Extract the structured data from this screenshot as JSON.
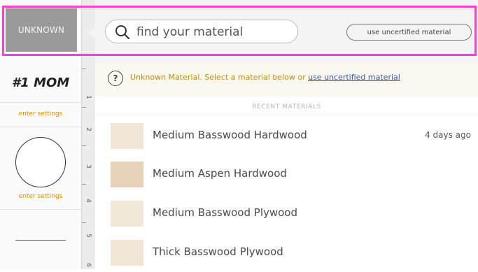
{
  "material_tab": {
    "label": "UNKNOWN"
  },
  "design_panel": {
    "title": "#1 MOM",
    "enter_settings_1": "enter settings",
    "enter_settings_2": "enter settings"
  },
  "ruler": {
    "marks": [
      "1",
      "2",
      "3",
      "4",
      "5",
      "6"
    ]
  },
  "search": {
    "placeholder": "find your material",
    "value": ""
  },
  "uncertified_button": {
    "label": "use uncertified material"
  },
  "notice": {
    "text": "Unknown Material. Select a material below or",
    "link": "use uncertified material"
  },
  "recent": {
    "header": "RECENT MATERIALS",
    "items": [
      {
        "name": "Medium Basswood Hardwood",
        "time": "4 days ago",
        "swatch_color": "#f1e6d6"
      },
      {
        "name": "Medium Aspen Hardwood",
        "time": "",
        "swatch_color": "#e6d2b7"
      },
      {
        "name": "Medium Basswood Plywood",
        "time": "",
        "swatch_color": "#f2e8da"
      },
      {
        "name": "Thick Basswood Plywood",
        "time": "",
        "swatch_color": "#f1e6d6"
      }
    ]
  },
  "colors": {
    "highlight": "#ff3fcf",
    "notice_text": "#c18a1f",
    "link": "#2f5f9a"
  }
}
